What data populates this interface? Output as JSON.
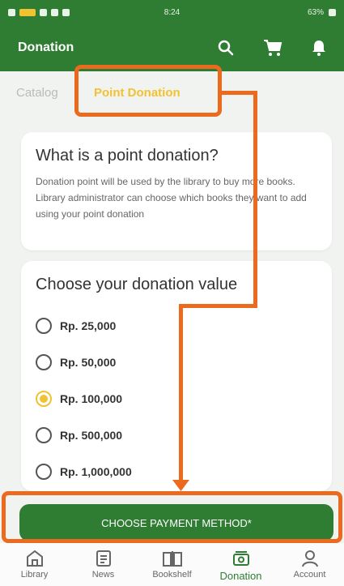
{
  "status_bar": {
    "time": "8:24",
    "battery": "63%"
  },
  "app_bar": {
    "title": "Donation",
    "icons": [
      "search-icon",
      "cart-icon",
      "bell-icon"
    ]
  },
  "tabs": [
    {
      "label": "Catalog",
      "active": false
    },
    {
      "label": "Point Donation",
      "active": true
    }
  ],
  "info_card": {
    "title": "What is a point donation?",
    "body": "Donation point will be used by the library to buy more books. Library administrator can choose which books they want to add using your point donation"
  },
  "donation_card": {
    "title": "Choose your donation value",
    "options": [
      {
        "label": "Rp. 25,000",
        "selected": false
      },
      {
        "label": "Rp. 50,000",
        "selected": false
      },
      {
        "label": "Rp. 100,000",
        "selected": true
      },
      {
        "label": "Rp. 500,000",
        "selected": false
      },
      {
        "label": "Rp. 1,000,000",
        "selected": false
      }
    ]
  },
  "pay_button": "CHOOSE PAYMENT METHOD*",
  "bottom_nav": [
    {
      "label": "Library",
      "icon": "library-icon",
      "active": false
    },
    {
      "label": "News",
      "icon": "news-icon",
      "active": false
    },
    {
      "label": "Bookshelf",
      "icon": "bookshelf-icon",
      "active": false
    },
    {
      "label": "Donation",
      "icon": "donation-icon",
      "active": true
    },
    {
      "label": "Account",
      "icon": "account-icon",
      "active": false
    }
  ],
  "colors": {
    "primary": "#2f7d32",
    "accent": "#f1c232",
    "annotation": "#ec6a1d"
  }
}
